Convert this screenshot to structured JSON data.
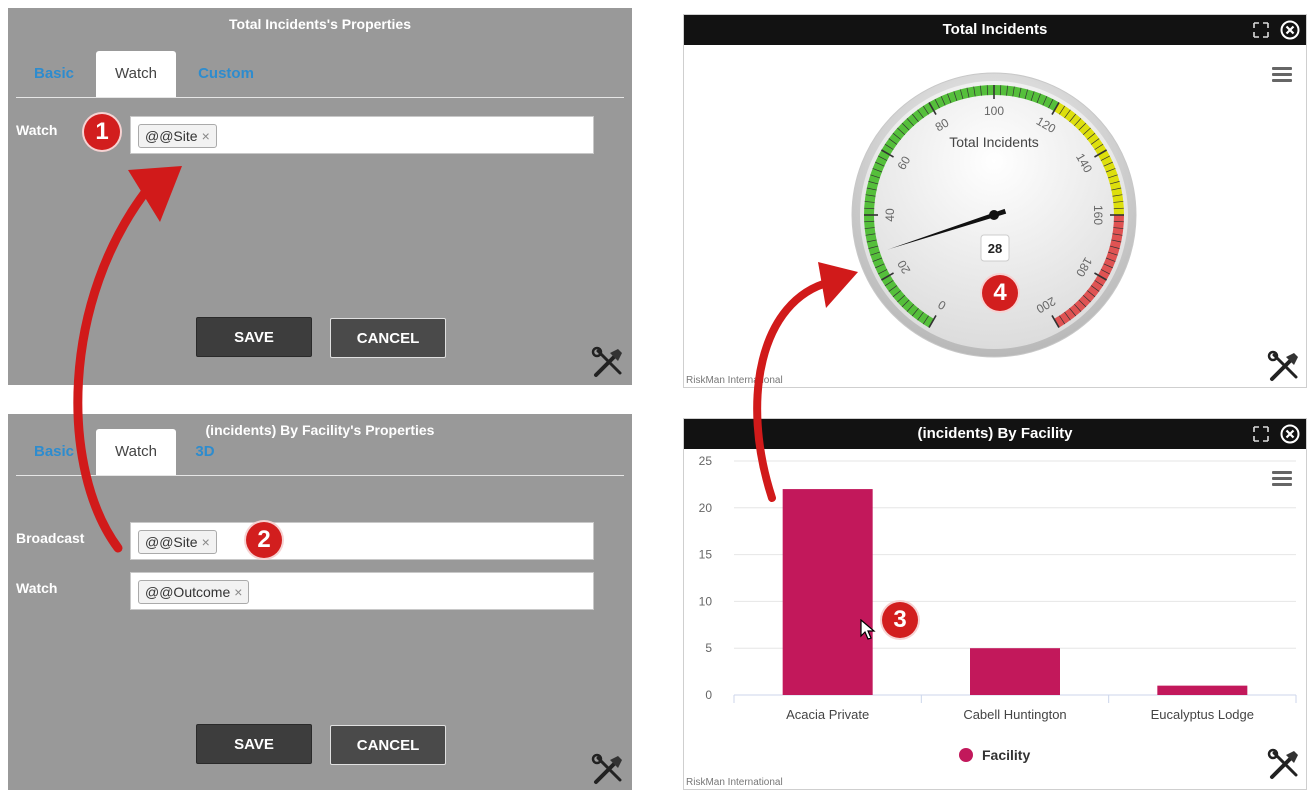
{
  "panel_top": {
    "title": "Total Incidents's Properties",
    "tabs": [
      "Basic",
      "Watch",
      "Custom"
    ],
    "active_tab": "Watch",
    "field_label": "Watch",
    "field_chip": "@@Site",
    "chip_remove": "×",
    "save_label": "SAVE",
    "cancel_label": "CANCEL"
  },
  "panel_bottom": {
    "title": "(incidents) By Facility's Properties",
    "tabs": [
      "Basic",
      "Watch",
      "3D"
    ],
    "active_tab": "Watch",
    "broadcast_label": "Broadcast",
    "broadcast_chip": "@@Site",
    "watch_label": "Watch",
    "watch_chip": "@@Outcome",
    "chip_remove": "×",
    "save_label": "SAVE",
    "cancel_label": "CANCEL"
  },
  "gauge_widget": {
    "title": "Total Incidents",
    "gauge_label": "Total Incidents",
    "value": 28,
    "value_text": "28",
    "min": 0,
    "max": 200,
    "tick_labels": [
      "0",
      "20",
      "40",
      "60",
      "80",
      "100",
      "120",
      "140",
      "160",
      "180",
      "200"
    ],
    "bands": [
      {
        "from": 0,
        "to": 120,
        "color": "#55bf3b"
      },
      {
        "from": 120,
        "to": 160,
        "color": "#dddf0d"
      },
      {
        "from": 160,
        "to": 200,
        "color": "#df5353"
      }
    ],
    "credit": "RiskMan International"
  },
  "bar_widget": {
    "title": "(incidents) By Facility",
    "credit": "RiskMan International",
    "legend_label": "Facility"
  },
  "chart_data": {
    "type": "bar",
    "categories": [
      "Acacia Private",
      "Cabell Huntington",
      "Eucalyptus Lodge"
    ],
    "series": [
      {
        "name": "Facility",
        "values": [
          22,
          5,
          1
        ],
        "color": "#c2185b"
      }
    ],
    "yticks": [
      "0",
      "5",
      "10",
      "15",
      "20",
      "25"
    ],
    "ylim": [
      0,
      25
    ],
    "grid": true,
    "legend": "bottom-center"
  },
  "annotations": [
    "1",
    "2",
    "3",
    "4"
  ],
  "colors": {
    "panel_bg": "#999999",
    "tab_link": "#2e8cce",
    "header_bg": "#121212",
    "badge": "#d21e1e",
    "arrow": "#d11a1a"
  },
  "icons": [
    "tools-icon",
    "expand-icon",
    "close-icon",
    "menu-icon",
    "cursor-icon"
  ]
}
